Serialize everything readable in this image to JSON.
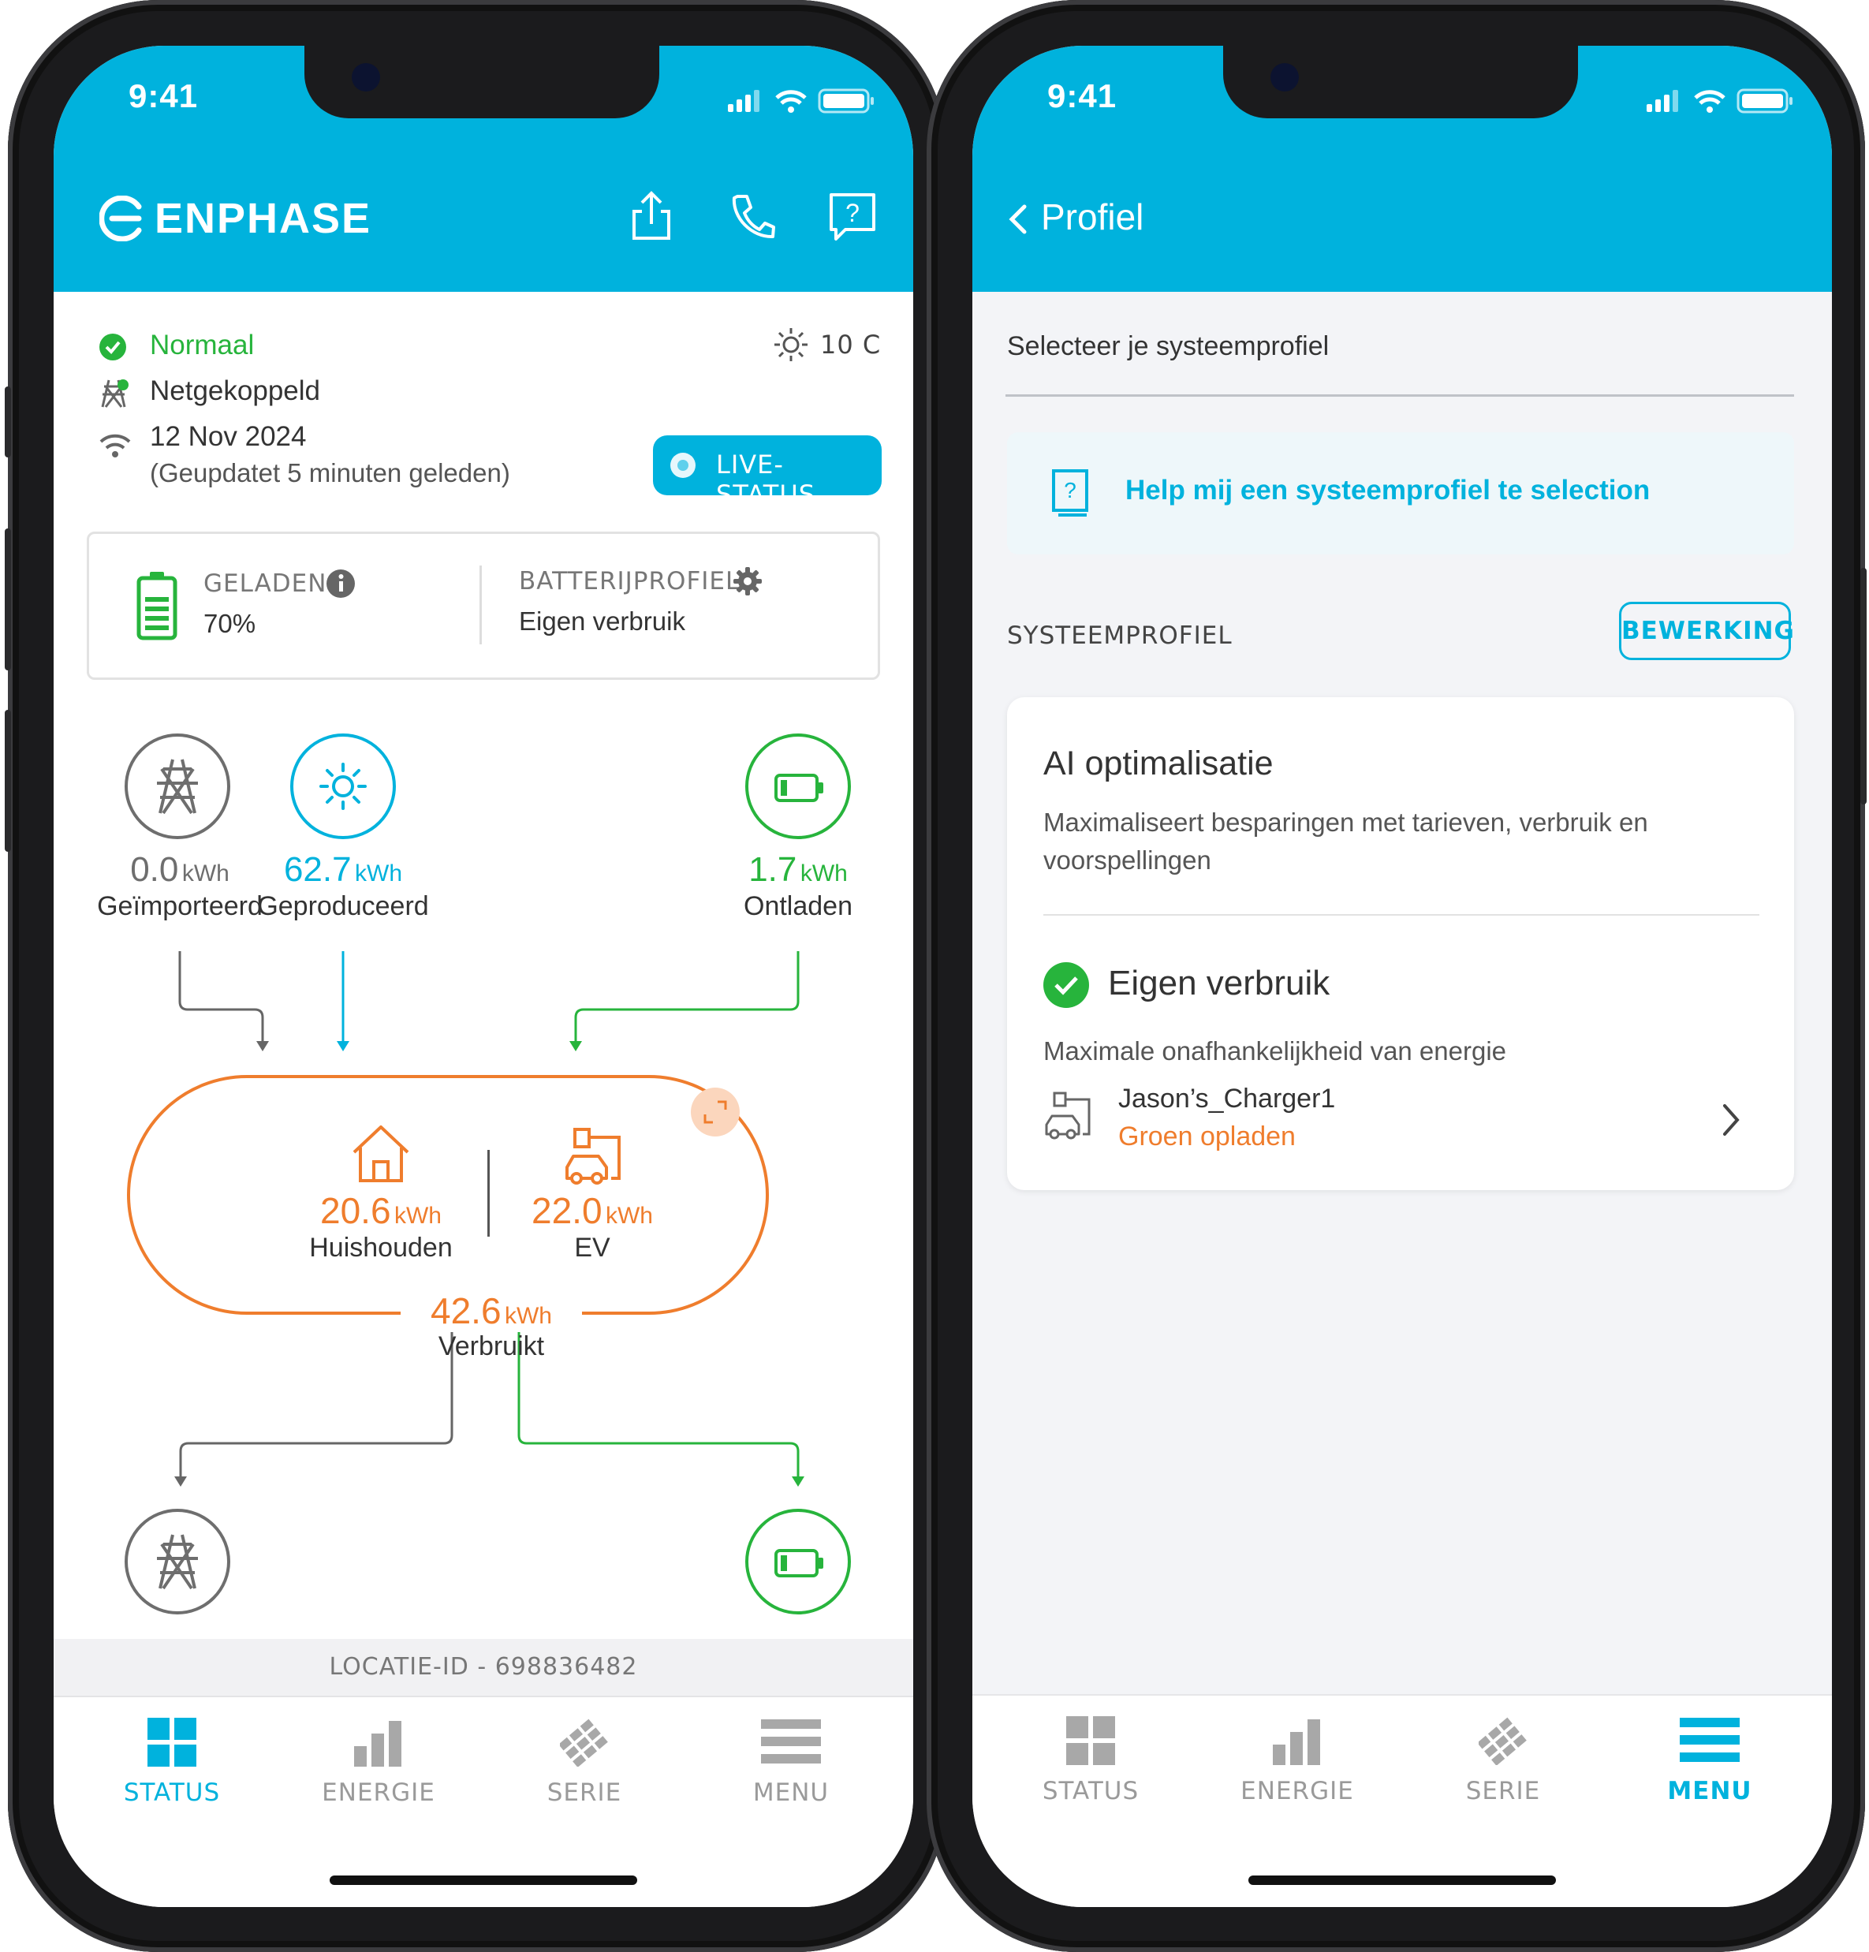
{
  "left_phone": {
    "status_time": "9:41",
    "brand": "ENPHASE",
    "status": {
      "normal_label": "Normaal",
      "grid_label": "Netgekoppeld",
      "date": "12 Nov 2024",
      "updated": "(Geupdatet 5 minuten geleden)",
      "temperature": "10 C",
      "live_button": "LIVE-STATUS"
    },
    "battery_card": {
      "charged_label": "GELADEN",
      "charged_value": "70%",
      "profile_label": "BATTERIJPROFIEL",
      "profile_value": "Eigen verbruik"
    },
    "flow": {
      "imported": {
        "value": "0.0",
        "unit": "kWh",
        "label": "Geïmporteerd"
      },
      "produced": {
        "value": "62.7",
        "unit": "kWh",
        "label": "Geproduceerd"
      },
      "discharged": {
        "value": "1.7",
        "unit": "kWh",
        "label": "Ontladen"
      },
      "household": {
        "value": "20.6",
        "unit": "kWh",
        "label": "Huishouden"
      },
      "ev": {
        "value": "22.0",
        "unit": "kWh",
        "label": "EV"
      },
      "consumed": {
        "value": "42.6",
        "unit": "kWh",
        "label": "Verbruikt"
      }
    },
    "location": "LOCATIE-ID - 698836482",
    "tabs": {
      "status": "STATUS",
      "energy": "ENERGIE",
      "series": "SERIE",
      "menu": "MENU"
    }
  },
  "right_phone": {
    "status_time": "9:41",
    "back_title": "Profiel",
    "select_text": "Selecteer je systeemprofiel",
    "help_link": "Help mij een systeemprofiel te selection",
    "section_title": "SYSTEEMPROFIEL",
    "edit_button": "BEWERKING",
    "ai_title": "AI optimalisatie",
    "ai_desc_line1": "Maximaliseert besparingen met tarieven, verbruik en",
    "ai_desc_line2": "voorspellingen",
    "own_title": "Eigen verbruik",
    "own_desc": "Maximale onafhankelijkheid van energie",
    "charger_name": "Jason’s_Charger1",
    "charger_mode": "Groen opladen",
    "tabs": {
      "status": "STATUS",
      "energy": "ENERGIE",
      "series": "SERIE",
      "menu": "MENU"
    }
  },
  "colors": {
    "brand_blue": "#00b2dd",
    "green": "#27b43c",
    "orange": "#ef7d2d",
    "grey": "#6e6e6e"
  }
}
